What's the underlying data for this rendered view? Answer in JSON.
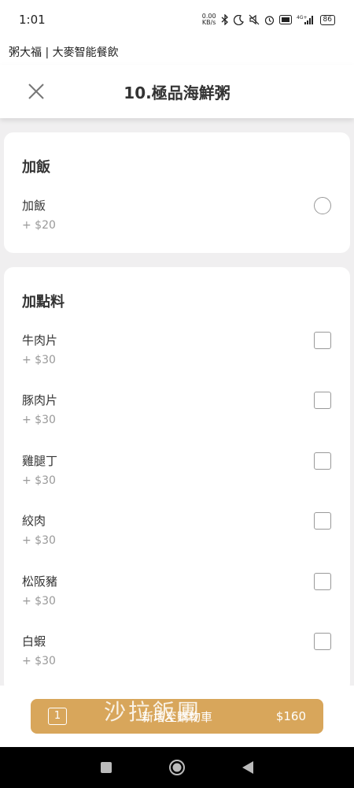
{
  "status_bar": {
    "time": "1:01",
    "net_speed_value": "0.00",
    "net_speed_unit": "KB/s",
    "signal_label": "4G+",
    "battery": "86",
    "icons": [
      "bluetooth-icon",
      "moon-icon",
      "mute-icon",
      "alarm-icon",
      "volte-icon",
      "signal-icon",
      "battery-icon"
    ]
  },
  "app_name": "粥大福 | 大麥智能餐飲",
  "header": {
    "title": "10.極品海鮮粥",
    "close_icon": "close-icon"
  },
  "sections": [
    {
      "title": "加飯",
      "type": "radio",
      "options": [
        {
          "name": "加飯",
          "price": "+ $20"
        }
      ]
    },
    {
      "title": "加點料",
      "type": "checkbox",
      "options": [
        {
          "name": "牛肉片",
          "price": "+ $30"
        },
        {
          "name": "豚肉片",
          "price": "+ $30"
        },
        {
          "name": "雞腿丁",
          "price": "+ $30"
        },
        {
          "name": "絞肉",
          "price": "+ $30"
        },
        {
          "name": "松阪豬",
          "price": "+ $30"
        },
        {
          "name": "白蝦",
          "price": "+ $30"
        }
      ]
    }
  ],
  "cart": {
    "count": "1",
    "label": "新增至購物車",
    "total": "$160"
  },
  "watermark": "沙拉飯團",
  "colors": {
    "accent": "#d8a65b",
    "background": "#f0eff0",
    "card": "#ffffff",
    "muted_text": "#999999",
    "nav_bar": "#000000"
  },
  "nav": [
    "recents-icon",
    "home-icon",
    "back-icon"
  ]
}
